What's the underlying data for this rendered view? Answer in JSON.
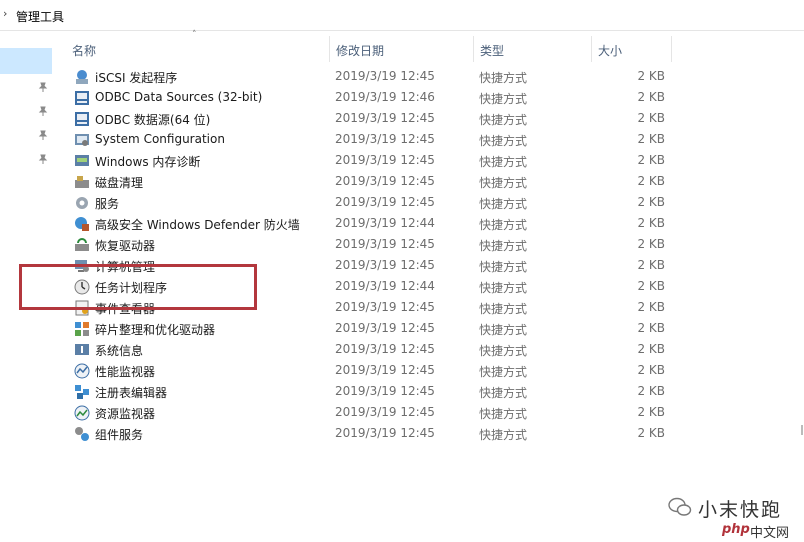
{
  "address": {
    "crumb": "管理工具"
  },
  "columns": {
    "name": "名称",
    "date": "修改日期",
    "type": "类型",
    "size": "大小"
  },
  "rows": [
    {
      "name": "iSCSI 发起程序",
      "date": "2019/3/19 12:45",
      "type": "快捷方式",
      "size": "2 KB",
      "icon": "iscsi-icon"
    },
    {
      "name": "ODBC Data Sources (32-bit)",
      "date": "2019/3/19 12:46",
      "type": "快捷方式",
      "size": "2 KB",
      "icon": "odbc-icon"
    },
    {
      "name": "ODBC 数据源(64 位)",
      "date": "2019/3/19 12:45",
      "type": "快捷方式",
      "size": "2 KB",
      "icon": "odbc-icon"
    },
    {
      "name": "System Configuration",
      "date": "2019/3/19 12:45",
      "type": "快捷方式",
      "size": "2 KB",
      "icon": "system-config-icon"
    },
    {
      "name": "Windows 内存诊断",
      "date": "2019/3/19 12:45",
      "type": "快捷方式",
      "size": "2 KB",
      "icon": "memory-diagnostic-icon"
    },
    {
      "name": "磁盘清理",
      "date": "2019/3/19 12:45",
      "type": "快捷方式",
      "size": "2 KB",
      "icon": "disk-cleanup-icon"
    },
    {
      "name": "服务",
      "date": "2019/3/19 12:45",
      "type": "快捷方式",
      "size": "2 KB",
      "icon": "services-icon"
    },
    {
      "name": "高级安全 Windows Defender 防火墙",
      "date": "2019/3/19 12:44",
      "type": "快捷方式",
      "size": "2 KB",
      "icon": "firewall-icon"
    },
    {
      "name": "恢复驱动器",
      "date": "2019/3/19 12:45",
      "type": "快捷方式",
      "size": "2 KB",
      "icon": "recovery-drive-icon"
    },
    {
      "name": "计算机管理",
      "date": "2019/3/19 12:45",
      "type": "快捷方式",
      "size": "2 KB",
      "icon": "computer-management-icon"
    },
    {
      "name": "任务计划程序",
      "date": "2019/3/19 12:44",
      "type": "快捷方式",
      "size": "2 KB",
      "icon": "task-scheduler-icon"
    },
    {
      "name": "事件查看器",
      "date": "2019/3/19 12:45",
      "type": "快捷方式",
      "size": "2 KB",
      "icon": "event-viewer-icon"
    },
    {
      "name": "碎片整理和优化驱动器",
      "date": "2019/3/19 12:45",
      "type": "快捷方式",
      "size": "2 KB",
      "icon": "defrag-icon"
    },
    {
      "name": "系统信息",
      "date": "2019/3/19 12:45",
      "type": "快捷方式",
      "size": "2 KB",
      "icon": "system-info-icon"
    },
    {
      "name": "性能监视器",
      "date": "2019/3/19 12:45",
      "type": "快捷方式",
      "size": "2 KB",
      "icon": "performance-monitor-icon"
    },
    {
      "name": "注册表编辑器",
      "date": "2019/3/19 12:45",
      "type": "快捷方式",
      "size": "2 KB",
      "icon": "registry-editor-icon"
    },
    {
      "name": "资源监视器",
      "date": "2019/3/19 12:45",
      "type": "快捷方式",
      "size": "2 KB",
      "icon": "resource-monitor-icon"
    },
    {
      "name": "组件服务",
      "date": "2019/3/19 12:45",
      "type": "快捷方式",
      "size": "2 KB",
      "icon": "component-services-icon"
    }
  ],
  "watermark": {
    "text": "小末快跑",
    "brand": "php",
    "site": "中文网"
  },
  "colors": {
    "highlight_box": "#b3373d",
    "nav_selection": "#cce8ff",
    "header_text": "#4c607a"
  }
}
